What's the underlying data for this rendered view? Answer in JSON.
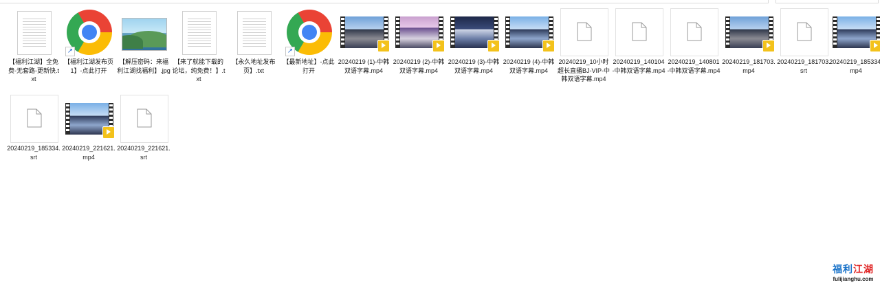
{
  "files": [
    {
      "name": "【福利江湖】全免费-无套路-更新快.txt",
      "icon": "text-file-icon"
    },
    {
      "name": "【福利江湖发布页1】-点此打开",
      "icon": "chrome-shortcut-icon"
    },
    {
      "name": "【解压密码：来福利江湖找福利】.jpg",
      "icon": "image-file-icon"
    },
    {
      "name": "【来了就能下载的论坛，纯免费！】.txt",
      "icon": "text-file-icon"
    },
    {
      "name": "【永久地址发布页】.txt",
      "icon": "text-file-icon"
    },
    {
      "name": "【最新地址】-点此打开",
      "icon": "chrome-shortcut-icon"
    },
    {
      "name": "20240219 (1)-中韩双语字幕.mp4",
      "icon": "video-file-icon"
    },
    {
      "name": "20240219 (2)-中韩双语字幕.mp4",
      "icon": "video-file-icon"
    },
    {
      "name": "20240219 (3)-中韩双语字幕.mp4",
      "icon": "video-file-icon"
    },
    {
      "name": "20240219 (4)-中韩双语字幕.mp4",
      "icon": "video-file-icon"
    },
    {
      "name": "20240219_10小时超长直播BJ-VIP-中韩双语字幕.mp4",
      "icon": "blank-file-icon"
    },
    {
      "name": "20240219_140104-中韩双语字幕.mp4",
      "icon": "blank-file-icon"
    },
    {
      "name": "20240219_140801-中韩双语字幕.mp4",
      "icon": "blank-file-icon"
    },
    {
      "name": "20240219_181703.mp4",
      "icon": "video-file-icon"
    },
    {
      "name": "20240219_181703.srt",
      "icon": "blank-file-icon"
    },
    {
      "name": "20240219_185334.mp4",
      "icon": "video-file-icon"
    },
    {
      "name": "20240219_185334.srt",
      "icon": "blank-file-icon"
    },
    {
      "name": "20240219_221621.mp4",
      "icon": "video-file-icon"
    },
    {
      "name": "20240219_221621.srt",
      "icon": "blank-file-icon"
    }
  ],
  "watermark": {
    "title_blue": "福利",
    "title_red": "江湖",
    "url": "fulijianghu.com"
  },
  "colors": {
    "player_badge": "#f3c21b",
    "watermark_blue": "#1a73c9",
    "watermark_red": "#e02424"
  }
}
